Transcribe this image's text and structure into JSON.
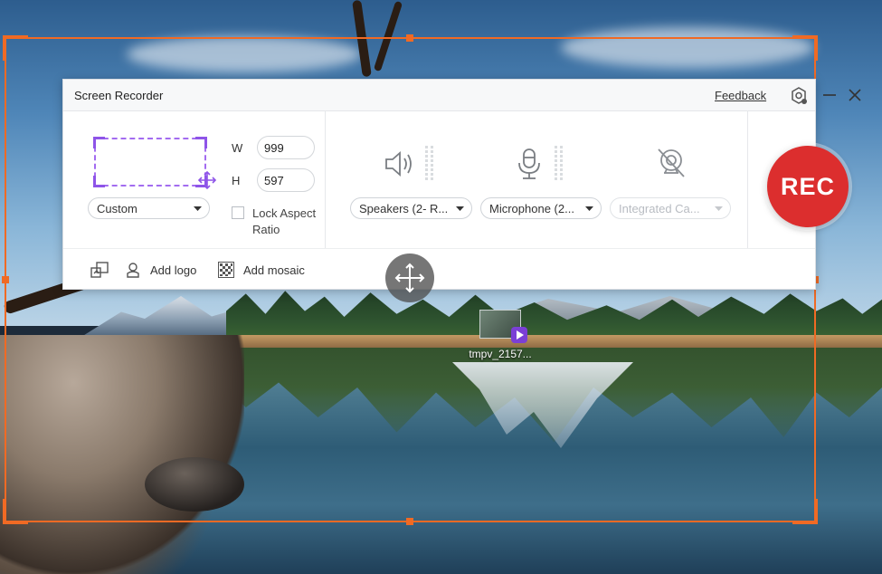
{
  "window": {
    "title": "Screen Recorder",
    "feedback_label": "Feedback"
  },
  "region": {
    "mode_selected": "Custom",
    "width_label": "W",
    "width_value": "999",
    "height_label": "H",
    "height_value": "597",
    "lock_aspect_label": "Lock Aspect Ratio",
    "lock_aspect_checked": false
  },
  "audio": {
    "speakers_selected": "Speakers (2- R...",
    "microphone_selected": "Microphone (2...",
    "camera_selected": "Integrated Ca..."
  },
  "tools": {
    "add_logo_label": "Add logo",
    "add_mosaic_label": "Add mosaic"
  },
  "record": {
    "label": "REC"
  },
  "desktop": {
    "file_label": "tmpv_2157..."
  },
  "colors": {
    "capture_border": "#f06a24",
    "region_dashed": "#a36cf0",
    "rec_button": "#dc2e2e"
  }
}
